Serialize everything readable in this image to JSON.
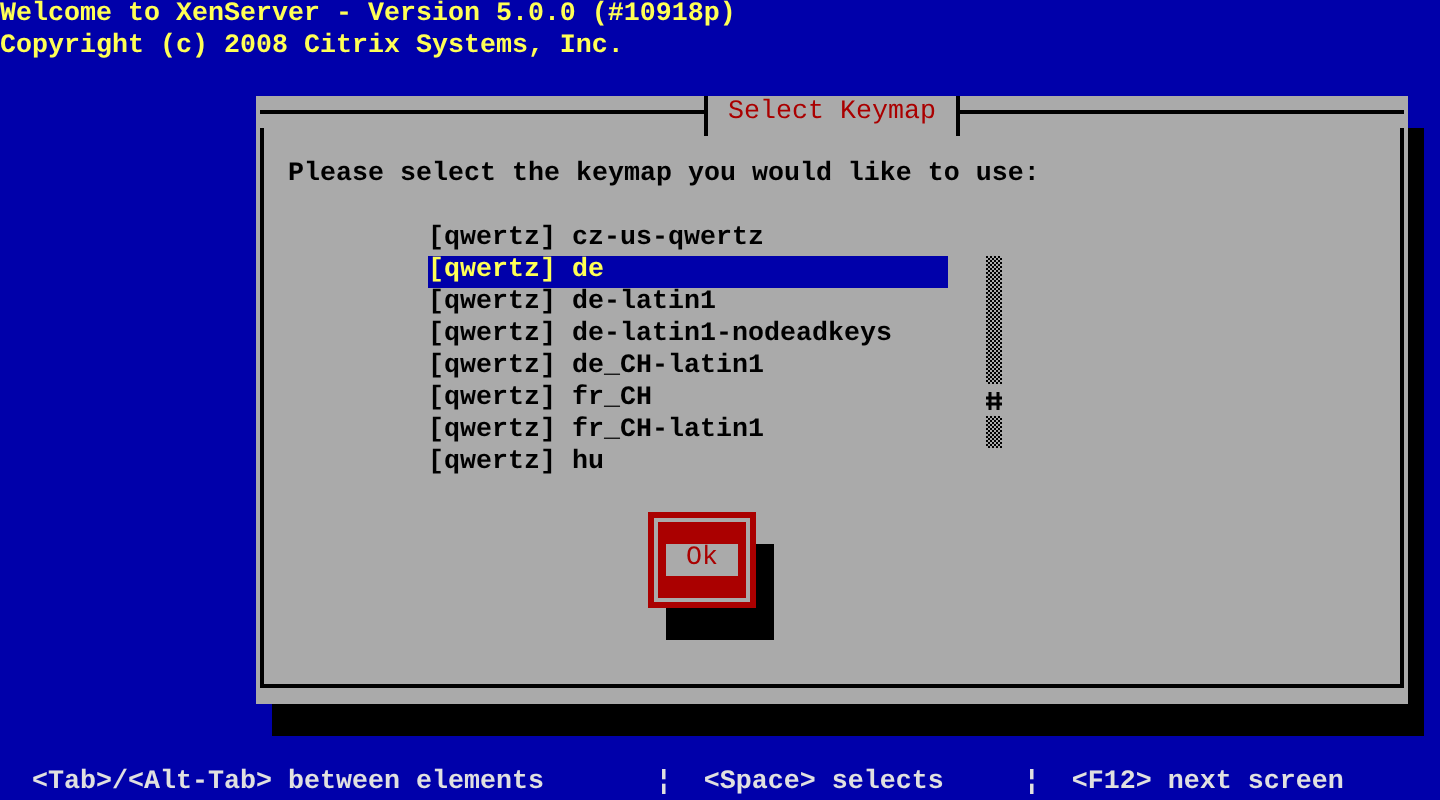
{
  "header": {
    "title": "Welcome to XenServer - Version 5.0.0 (#10918p)",
    "copyright": "Copyright (c) 2008 Citrix Systems, Inc."
  },
  "dialog": {
    "title": "Select Keymap",
    "prompt": "Please select the keymap you would like to use:",
    "items": [
      {
        "label": "[qwertz] cz-us-qwertz",
        "selected": false
      },
      {
        "label": "[qwertz] de",
        "selected": true
      },
      {
        "label": "[qwertz] de-latin1",
        "selected": false
      },
      {
        "label": "[qwertz] de-latin1-nodeadkeys",
        "selected": false
      },
      {
        "label": "[qwertz] de_CH-latin1",
        "selected": false
      },
      {
        "label": "[qwertz] fr_CH",
        "selected": false
      },
      {
        "label": "[qwertz] fr_CH-latin1",
        "selected": false
      },
      {
        "label": "[qwertz] hu",
        "selected": false
      }
    ],
    "buttons": [
      {
        "label": "Ok",
        "focused": true
      }
    ]
  },
  "help_bar": "<Tab>/<Alt-Tab> between elements       ¦  <Space> selects     ¦  <F12> next screen"
}
